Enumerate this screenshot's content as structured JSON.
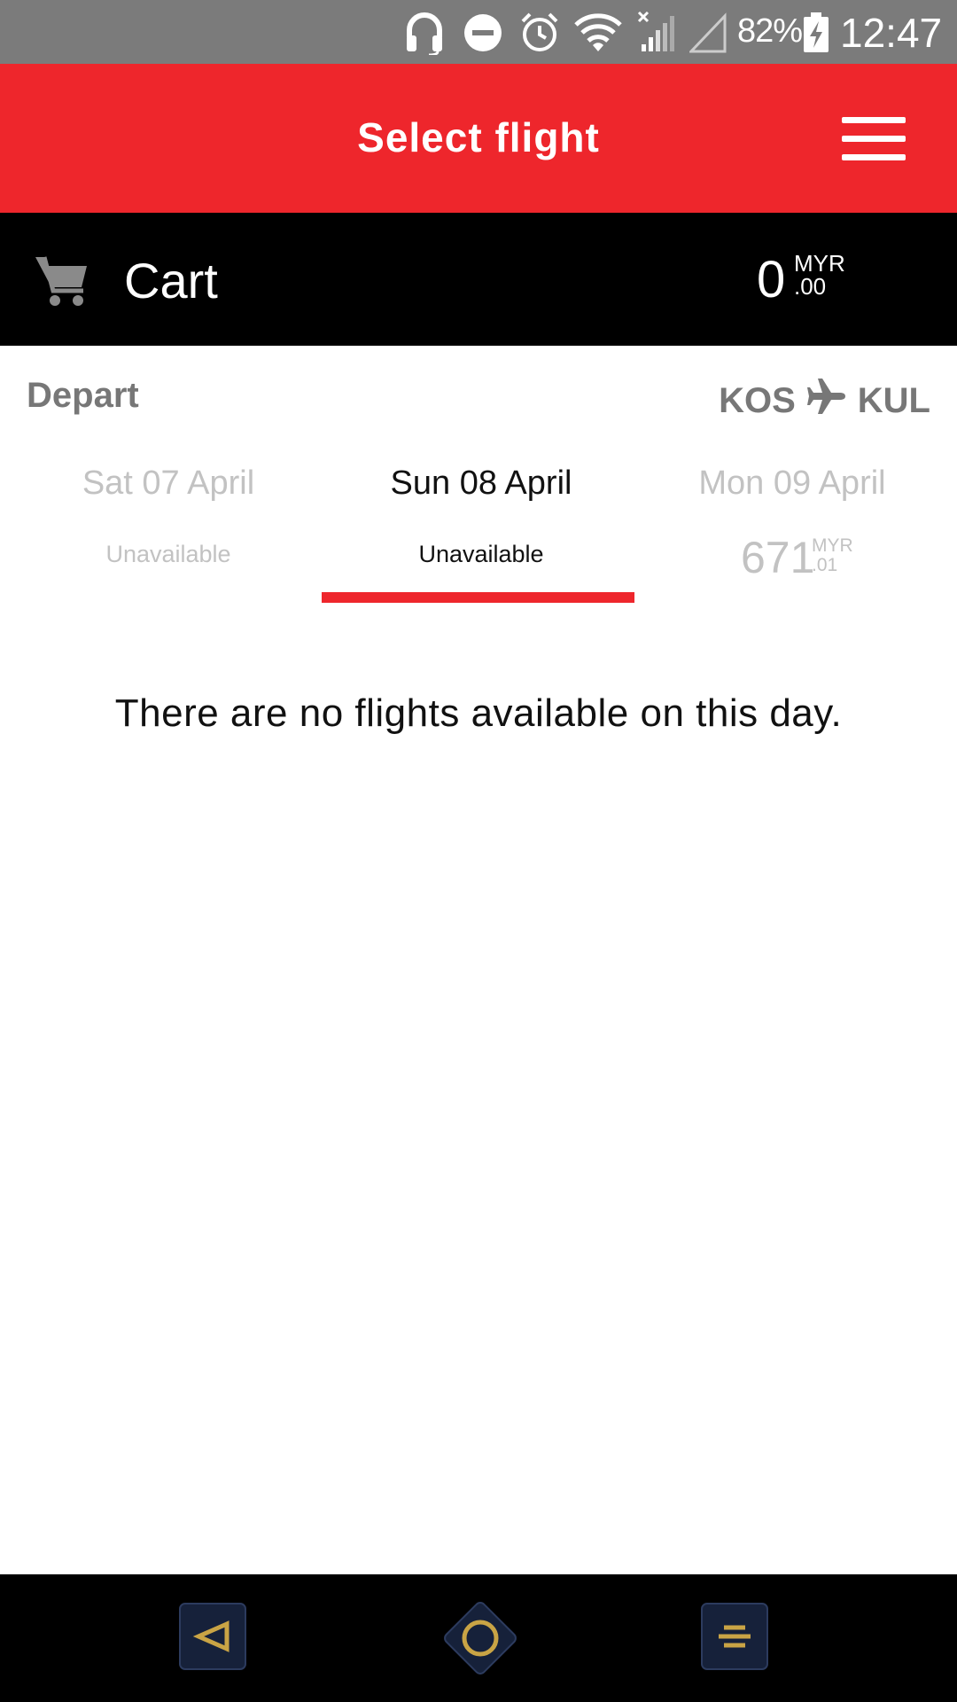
{
  "status_bar": {
    "battery_percent": "82%",
    "time": "12:47",
    "icons": [
      "headset-icon",
      "do-not-disturb-icon",
      "alarm-icon",
      "wifi-icon",
      "cell-signal-icon",
      "cell-signal-empty-icon",
      "battery-charging-icon"
    ]
  },
  "header": {
    "title": "Select flight",
    "menu_icon": "hamburger-menu-icon",
    "background": "#ee262c"
  },
  "cart": {
    "label": "Cart",
    "icon": "shopping-cart-icon",
    "amount_integer": "0",
    "amount_currency": "MYR",
    "amount_decimal": ".00"
  },
  "trip": {
    "direction_label": "Depart",
    "origin": "KOS",
    "destination": "KUL",
    "route_icon": "airplane-icon"
  },
  "date_tabs": [
    {
      "date": "Sat 07 April",
      "availability": "Unavailable",
      "selected": false
    },
    {
      "date": "Sun 08 April",
      "availability": "Unavailable",
      "selected": true
    },
    {
      "date": "Mon 09 April",
      "price_integer": "671",
      "price_currency": "MYR",
      "price_decimal": ".01",
      "selected": false
    }
  ],
  "message": "There are no flights available on this day.",
  "nav_bar": {
    "icons": [
      "back-icon",
      "home-icon",
      "recents-icon"
    ],
    "accent": "#c9a445"
  }
}
